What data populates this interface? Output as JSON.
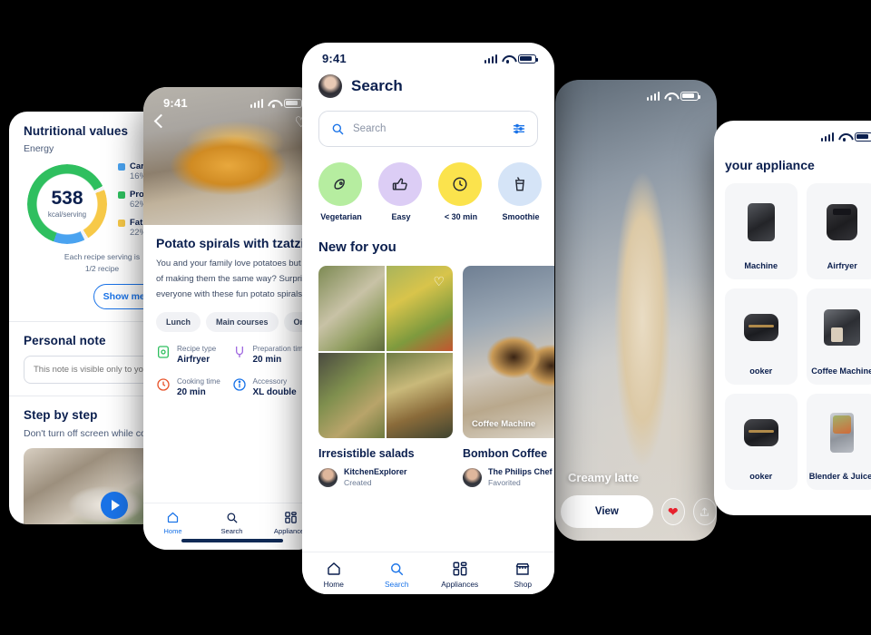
{
  "panel_nutrition": {
    "title": "Nutritional values",
    "energy_label": "Energy",
    "kcal_value": "538",
    "kcal_unit": "kcal/serving",
    "legend": [
      {
        "name": "Carbs",
        "percent": "16%",
        "color": "#4aa3f0"
      },
      {
        "name": "Protein",
        "percent": "62%",
        "color": "#2fbf5f"
      },
      {
        "name": "Fat",
        "percent": "22%",
        "color": "#f7c948"
      }
    ],
    "serving_note_line1": "Each recipe serving is",
    "serving_note_line2": "1/2 recipe",
    "show_more_label": "Show me more",
    "personal_note_title": "Personal note",
    "personal_note_placeholder": "This note is visible only to you",
    "step_title": "Step by step",
    "step_sub": "Don't turn off screen while cooking"
  },
  "panel_recipe": {
    "status_time": "9:41",
    "title": "Potato spirals with tzatziki",
    "description_line1": "You and your family love potatoes but tired",
    "description_line2": "of making them the same way? Surprise",
    "description_line3": "everyone with these fun potato spirals",
    "chips": [
      "Lunch",
      "Main courses",
      "One pot"
    ],
    "meta": [
      {
        "label": "Recipe type",
        "value": "Airfryer",
        "icon": "airfryer-icon"
      },
      {
        "label": "Preparation time",
        "value": "20 min",
        "icon": "prep-icon"
      },
      {
        "label": "Cooking time",
        "value": "20 min",
        "icon": "clock-icon"
      },
      {
        "label": "Accessory",
        "value": "XL double",
        "icon": "info-icon"
      }
    ],
    "tabs": [
      {
        "label": "Home",
        "icon": "home-icon",
        "active": true
      },
      {
        "label": "Search",
        "icon": "search-icon",
        "active": false
      },
      {
        "label": "Appliances",
        "icon": "appliances-icon",
        "active": false
      }
    ]
  },
  "panel_search": {
    "status_time": "9:41",
    "header_title": "Search",
    "search_placeholder": "Search",
    "search_value": "",
    "search_icon": "search-icon",
    "filter_icon": "filter-sliders-icon",
    "categories": [
      {
        "label": "Vegetarian",
        "icon": "leaf-icon",
        "color": "#b6eda0"
      },
      {
        "label": "Easy",
        "icon": "thumbs-up-icon",
        "color": "#dccdf5"
      },
      {
        "label": "< 30 min",
        "icon": "clock-icon",
        "color": "#fbe34d"
      },
      {
        "label": "Smoothie",
        "icon": "smoothie-icon",
        "color": "#d5e4f7"
      }
    ],
    "section_title": "New for you",
    "cards": [
      {
        "name": "Irresistible salads",
        "author": "KitchenExplorer",
        "relation": "Created",
        "favorited": true,
        "caption": ""
      },
      {
        "name": "Bombon Coffee",
        "author": "The Philips Chef",
        "relation": "Favorited",
        "favorited": false,
        "caption": "Coffee Machine"
      }
    ],
    "tabs": [
      {
        "label": "Home",
        "icon": "home-icon",
        "active": false
      },
      {
        "label": "Search",
        "icon": "search-icon",
        "active": true
      },
      {
        "label": "Appliances",
        "icon": "appliances-icon",
        "active": false
      },
      {
        "label": "Shop",
        "icon": "shop-icon",
        "active": false
      }
    ]
  },
  "panel_latte": {
    "caption": "Creamy latte",
    "view_label": "View",
    "favorite_icon": "heart-filled-icon",
    "share_icon": "share-icon"
  },
  "panel_appliances": {
    "title": "your appliance",
    "items": [
      {
        "label": "Machine",
        "device": "mach"
      },
      {
        "label": "Airfryer",
        "device": "airfryer"
      },
      {
        "label": "ooker",
        "device": "cooker"
      },
      {
        "label": "Coffee Machine",
        "device": "coffee"
      },
      {
        "label": "ooker",
        "device": "cooker"
      },
      {
        "label": "Blender & Juicer",
        "device": "blender"
      }
    ]
  },
  "theme": {
    "navy": "#0b1f4e",
    "blue": "#1a73e8",
    "green": "#2fbf5f",
    "yellow": "#f7c948",
    "red": "#e8222e"
  }
}
